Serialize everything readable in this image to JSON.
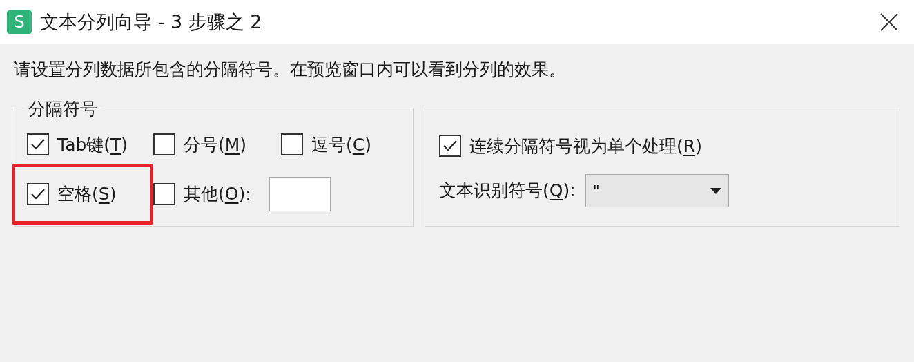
{
  "window": {
    "title": "文本分列向导 - 3 步骤之 2",
    "icon_letter": "S"
  },
  "instruction": "请设置分列数据所包含的分隔符号。在预览窗口内可以看到分列的效果。",
  "delimiters": {
    "legend": "分隔符号",
    "rows": [
      [
        {
          "before": "Tab键(",
          "mnemonic": "T",
          "after": ")",
          "checked": true,
          "highlighted": false
        },
        {
          "before": "分号(",
          "mnemonic": "M",
          "after": ")",
          "checked": false,
          "highlighted": false
        },
        {
          "before": "逗号(",
          "mnemonic": "C",
          "after": ")",
          "checked": false,
          "highlighted": false
        }
      ],
      [
        {
          "before": "空格(",
          "mnemonic": "S",
          "after": ")",
          "checked": true,
          "highlighted": true
        },
        {
          "before": "其他(",
          "mnemonic": "O",
          "after": "):",
          "checked": false,
          "highlighted": false,
          "has_field": true
        }
      ]
    ]
  },
  "options": {
    "consecutive": {
      "before": "连续分隔符号视为单个处理(",
      "mnemonic": "R",
      "after": ")",
      "checked": true
    },
    "qualifier": {
      "before": "文本识别符号(",
      "mnemonic": "Q",
      "after": "):",
      "value": "\""
    }
  }
}
